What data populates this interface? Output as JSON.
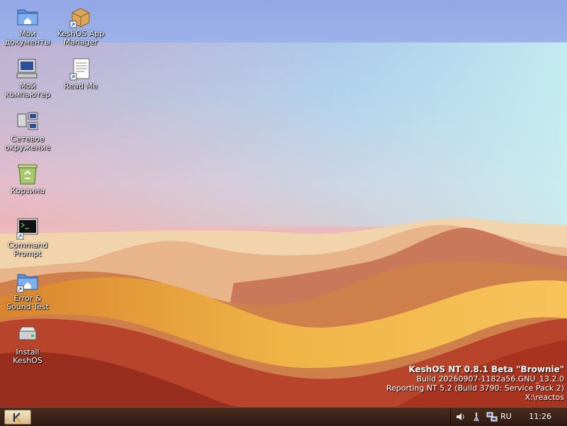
{
  "desktop": {
    "icons": [
      {
        "name": "my-documents",
        "label": "Мои документы"
      },
      {
        "name": "keshos-app-manager",
        "label": "KeshOS App Manager"
      },
      {
        "name": "my-computer",
        "label": "Мой компьютер"
      },
      {
        "name": "read-me",
        "label": "Read Me"
      },
      {
        "name": "network-places",
        "label": "Сетевое окружение"
      },
      {
        "name": "recycle-bin",
        "label": "Корзина"
      },
      {
        "name": "command-prompt",
        "label": "Command Prompt"
      },
      {
        "name": "error-sound-test",
        "label": "Error & Sound Test"
      },
      {
        "name": "install-keshos",
        "label": "Install KeshOS"
      }
    ]
  },
  "version": {
    "title": "KeshOS NT 0.8.1 Beta \"Brownie\"",
    "build": "Build 20260907-1182a56.GNU_13.2.0",
    "reporting": "Reporting NT 5.2 (Build 3790: Service Pack 2)",
    "path": "X:\\reactos"
  },
  "taskbar": {
    "language": "RU",
    "clock": "11:26"
  },
  "colors": {
    "taskbar": "#3a2218",
    "sky_top": "#8fa8e4",
    "dune_dark": "#b9462c",
    "dune_gold": "#e8a33a"
  }
}
